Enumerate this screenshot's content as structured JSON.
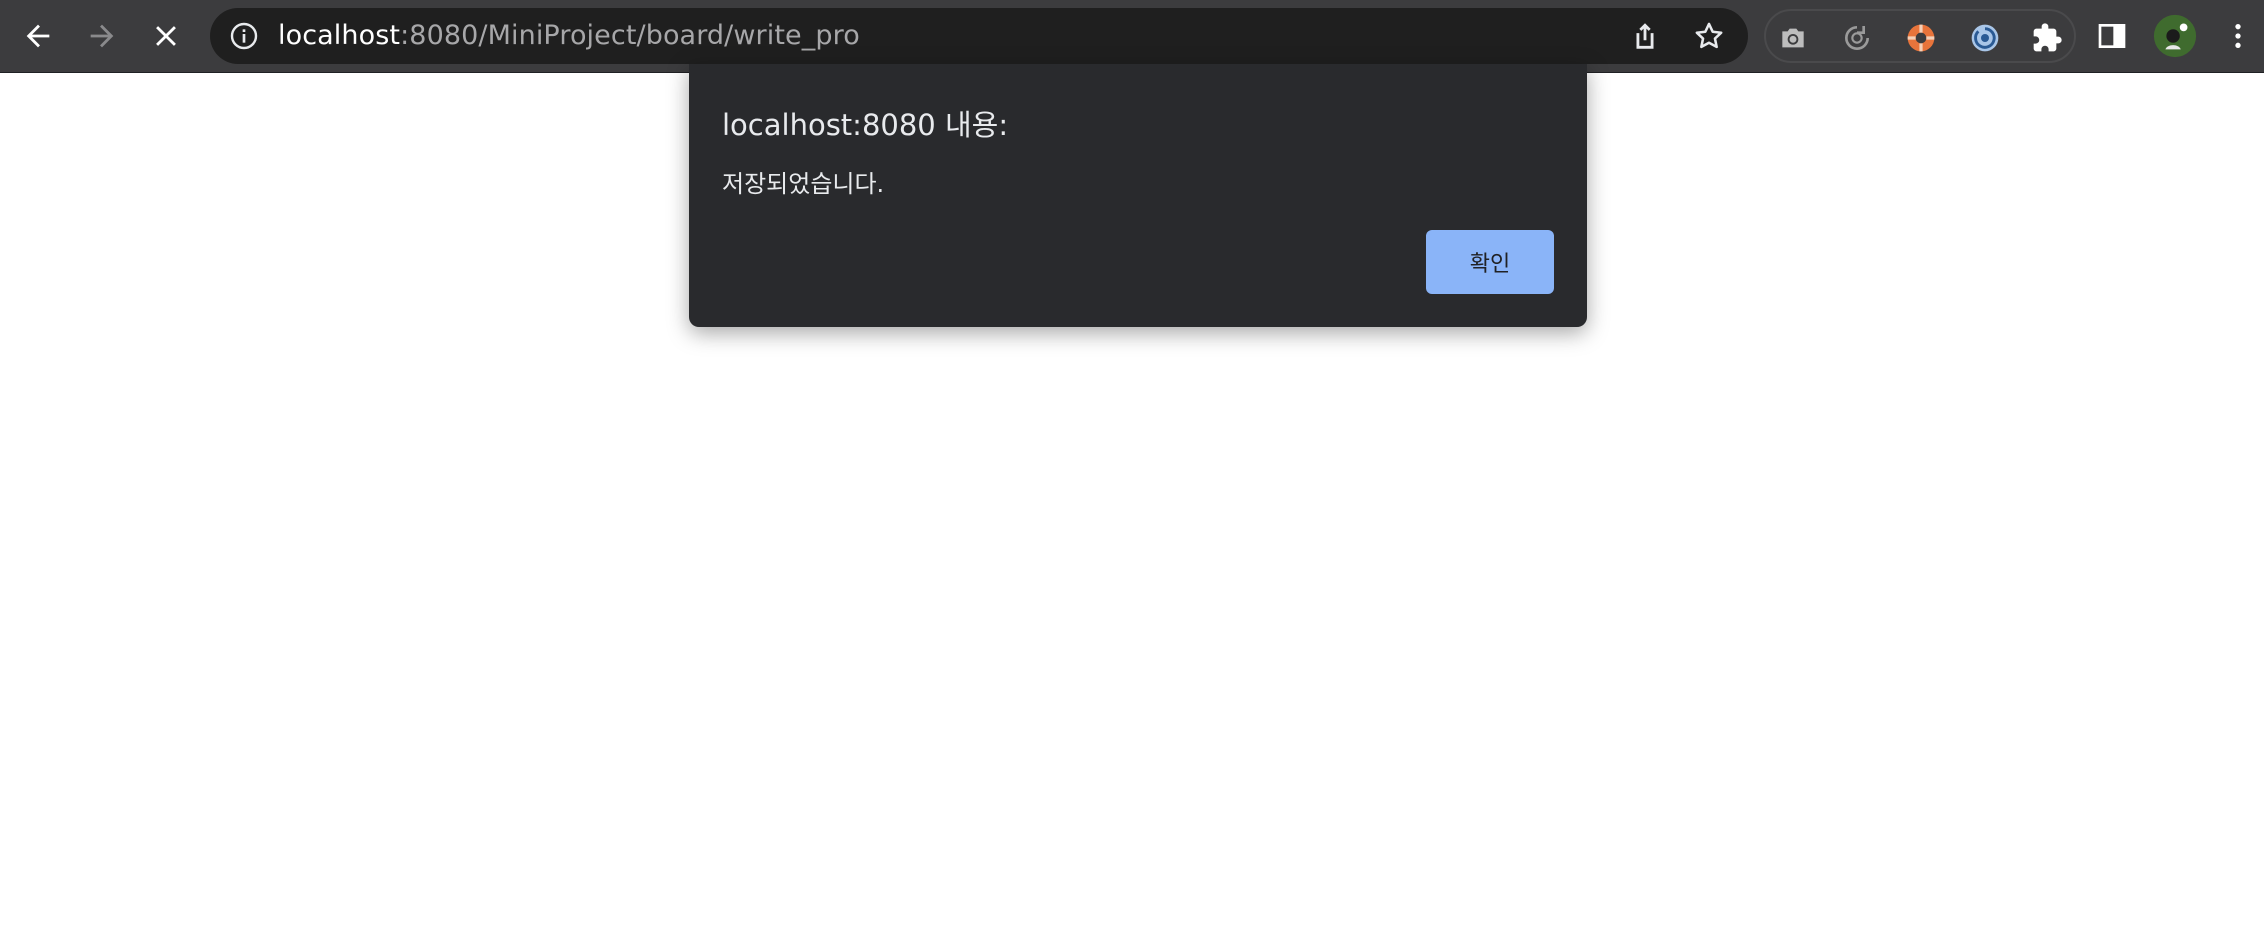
{
  "browser": {
    "url_host": "localhost",
    "url_rest": ":8080/MiniProject/board/write_pro",
    "icons": {
      "back": "back-arrow-icon",
      "forward": "forward-arrow-icon",
      "stop": "close-icon",
      "site_info": "info-icon",
      "share": "share-icon",
      "bookmark": "star-icon",
      "ext1": "camera-icon",
      "ext2": "refresh-clock-icon",
      "ext3": "lifebuoy-icon",
      "ext4": "swirl-icon",
      "extensions": "puzzle-icon",
      "side_panel": "side-panel-icon",
      "profile": "avatar",
      "menu": "kebab-menu-icon"
    }
  },
  "dialog": {
    "title": "localhost:8080 내용:",
    "message": "저장되었습니다.",
    "ok_label": "확인"
  },
  "colors": {
    "toolbar_bg": "#3c3c3e",
    "omnibox_bg": "#1f1f1f",
    "dialog_bg": "#292a2d",
    "button_bg": "#8ab4f8",
    "page_bg": "#ffffff"
  }
}
